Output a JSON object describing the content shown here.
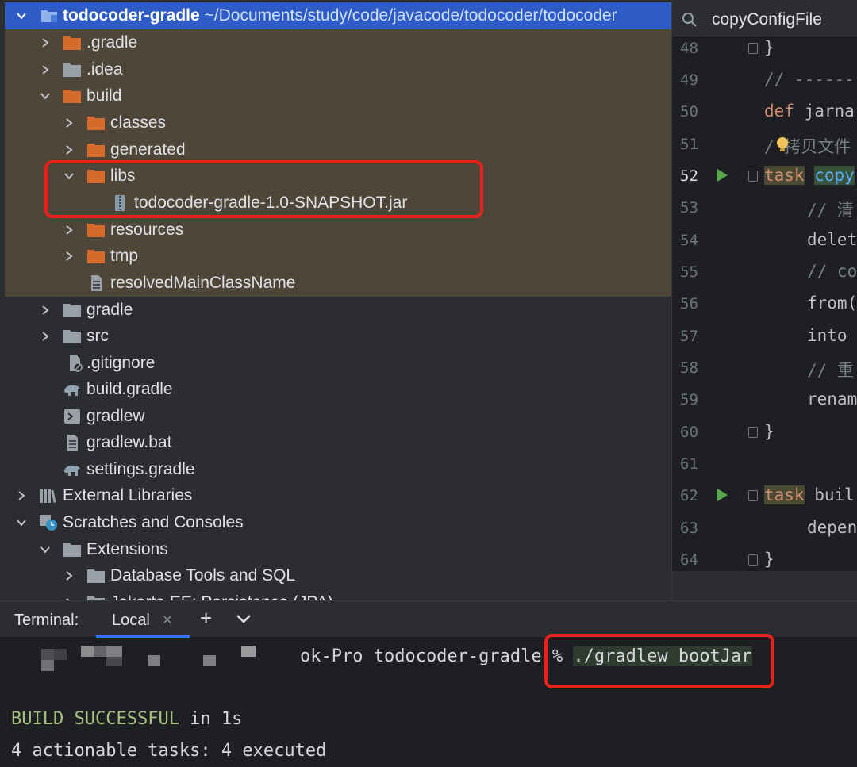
{
  "project_tree": {
    "root": {
      "name": "todocoder-gradle",
      "path": "~/Documents/study/code/javacode/todocoder/todocoder"
    },
    "items": [
      {
        "label": ".gradle"
      },
      {
        "label": ".idea"
      },
      {
        "label": "build"
      },
      {
        "label": "classes"
      },
      {
        "label": "generated"
      },
      {
        "label": "libs"
      },
      {
        "label": "todocoder-gradle-1.0-SNAPSHOT.jar"
      },
      {
        "label": "resources"
      },
      {
        "label": "tmp"
      },
      {
        "label": "resolvedMainClassName"
      },
      {
        "label": "gradle"
      },
      {
        "label": "src"
      },
      {
        "label": ".gitignore"
      },
      {
        "label": "build.gradle"
      },
      {
        "label": "gradlew"
      },
      {
        "label": "gradlew.bat"
      },
      {
        "label": "settings.gradle"
      },
      {
        "label": "External Libraries"
      },
      {
        "label": "Scratches and Consoles"
      },
      {
        "label": "Extensions"
      },
      {
        "label": "Database Tools and SQL"
      },
      {
        "label": "Jakarta EE: Persistence (JPA)"
      }
    ]
  },
  "editor": {
    "search_text": "copyConfigFile",
    "line_numbers": [
      "48",
      "49",
      "50",
      "51",
      "52",
      "53",
      "54",
      "55",
      "56",
      "57",
      "58",
      "59",
      "60",
      "61",
      "62",
      "63",
      "64"
    ],
    "lines": {
      "l48": "}",
      "l49": "// ------",
      "l50_kw": "def",
      "l50_rest": " jarna",
      "l51": "/ 拷贝文件",
      "l52_kw": "task",
      "l52_rest": "copy",
      "l53": "// 清",
      "l54": "delet",
      "l55": "// co",
      "l56": "from(",
      "l57": "into ",
      "l58": "// 重",
      "l59": "renam",
      "l60": "}",
      "l62_kw": "task",
      "l62_rest": " buil",
      "l63": "depen",
      "l64": "}"
    }
  },
  "terminal": {
    "title": "Terminal:",
    "tab_label": "Local",
    "prompt_text": "ok-Pro todocoder-gradle % ",
    "command": "./gradlew bootJar",
    "result_word1": "BUILD",
    "result_word2": "SUCCESSFUL",
    "result_rest": " in 1s",
    "summary": "4 actionable tasks: 4 executed"
  },
  "colors": {
    "selection": "#2e5bc6",
    "excluded_bg": "#4e4639",
    "folder_orange": "#d46a2c",
    "annotation_red": "#e8221b",
    "success_green": "#a7c080"
  }
}
